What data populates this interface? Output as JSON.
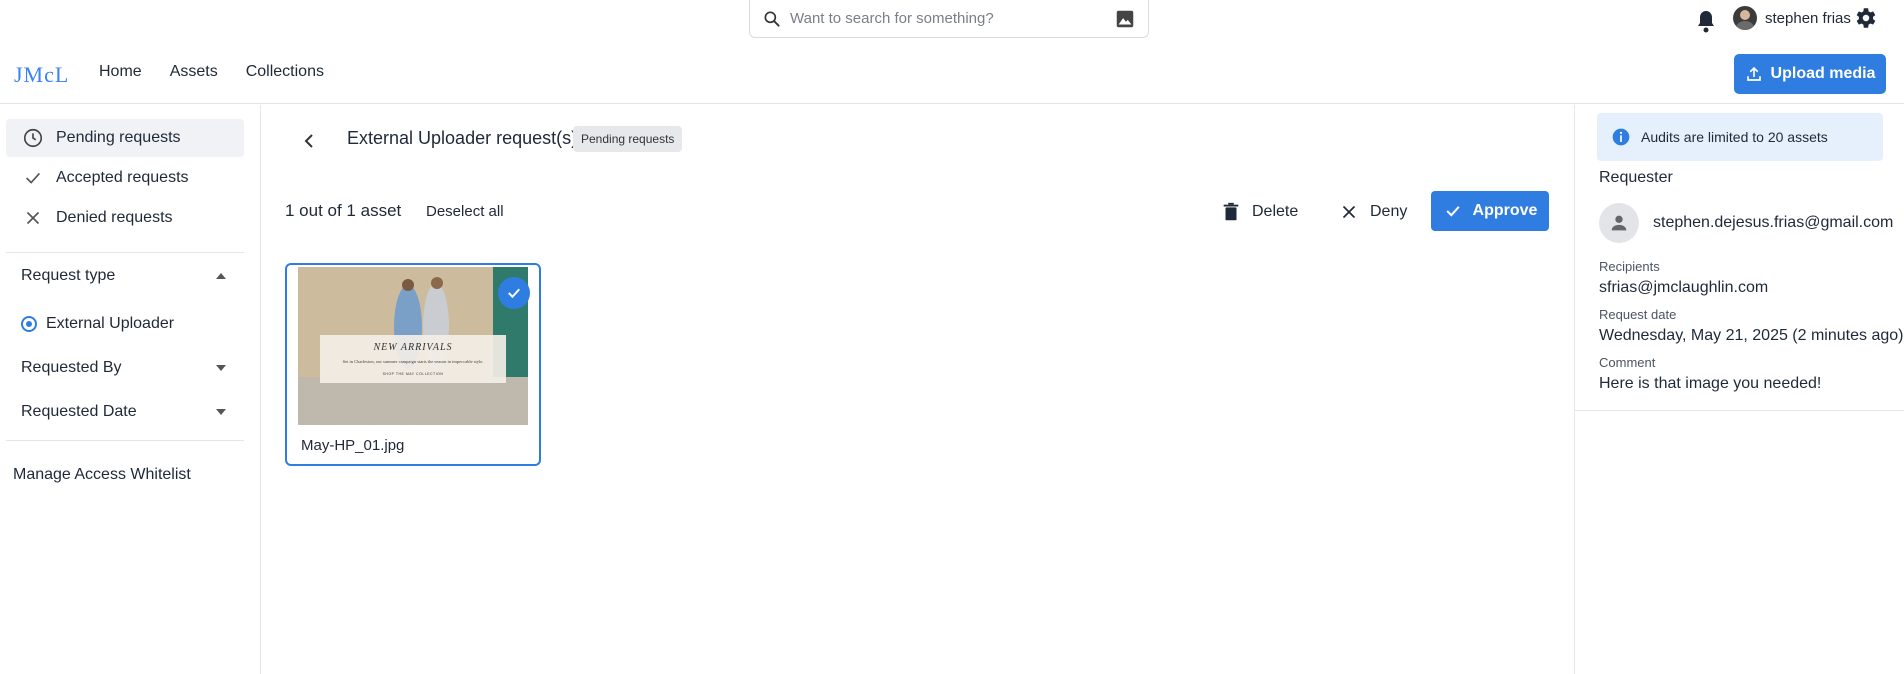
{
  "header": {
    "search_placeholder": "Want to search for something?",
    "user_name": "stephen frias",
    "logo_text": "JMcL",
    "nav": [
      "Home",
      "Assets",
      "Collections"
    ],
    "upload_label": "Upload media"
  },
  "sidebar": {
    "items": [
      {
        "label": "Pending requests",
        "icon": "clock-icon",
        "active": true
      },
      {
        "label": "Accepted requests",
        "icon": "check-icon",
        "active": false
      },
      {
        "label": "Denied requests",
        "icon": "close-icon",
        "active": false
      }
    ],
    "filters": {
      "request_type": "Request type",
      "request_type_option": "External Uploader",
      "requested_by": "Requested By",
      "requested_date": "Requested Date"
    },
    "manage_label": "Manage Access Whitelist"
  },
  "main": {
    "title": "External Uploader request(s)",
    "badge": "Pending requests",
    "count_text": "1 out of 1 asset",
    "deselect_label": "Deselect all",
    "delete_label": "Delete",
    "deny_label": "Deny",
    "approve_label": "Approve",
    "asset": {
      "file_name": "May-HP_01.jpg",
      "image_headline": "NEW ARRIVALS",
      "image_body": "Set in Charleston, our summer campaign starts the season in impeccable style.",
      "image_cta": "SHOP THE MAY COLLECTION"
    }
  },
  "panel": {
    "info_text": "Audits are limited to 20 assets",
    "requester_heading": "Requester",
    "requester_email": "stephen.dejesus.frias@gmail.com",
    "recipients_label": "Recipients",
    "recipients_value": "sfrias@jmclaughlin.com",
    "date_label": "Request date",
    "date_value": "Wednesday, May 21, 2025 (2 minutes ago)",
    "comment_label": "Comment",
    "comment_value": "Here is that image you needed!"
  },
  "colors": {
    "accent": "#2f7de1",
    "info_bg": "#e6effc",
    "active_bg": "#f0f2f5"
  }
}
